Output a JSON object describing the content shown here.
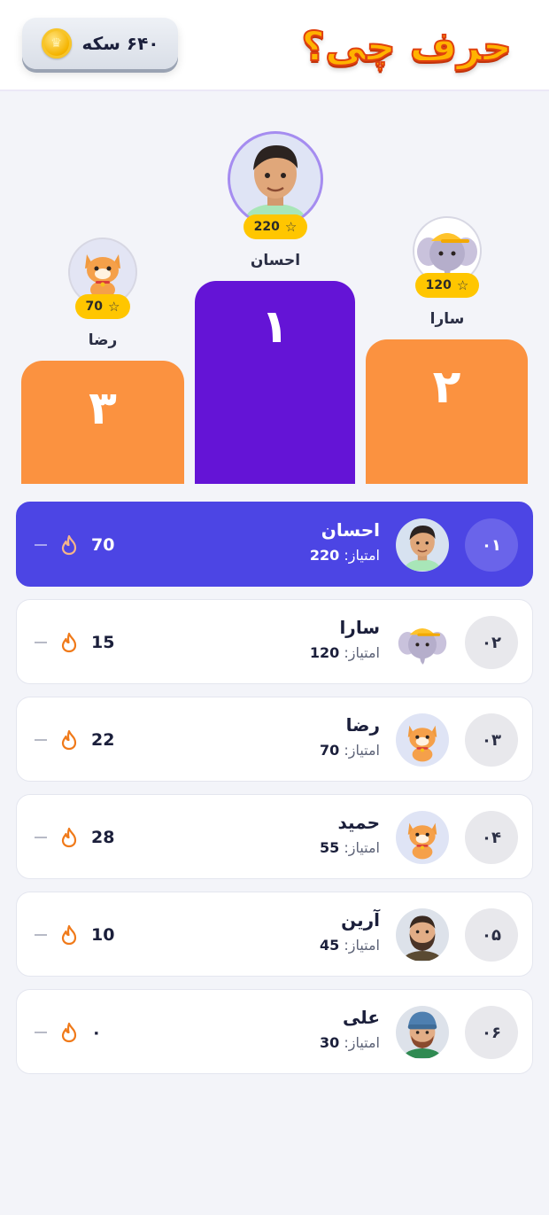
{
  "header": {
    "logo_text": "حرف چی؟",
    "coins": "۶۴۰ سکه",
    "coin_icon": "coin-icon"
  },
  "podium": [
    {
      "place": "۱",
      "name": "احسان",
      "score": "220",
      "avatar": "boy-avatar",
      "color": "#6414d6"
    },
    {
      "place": "۲",
      "name": "سارا",
      "score": "120",
      "avatar": "elephant-avatar",
      "color": "#fb9240"
    },
    {
      "place": "۳",
      "name": "رضا",
      "score": "70",
      "avatar": "cat-avatar",
      "color": "#fb9240"
    }
  ],
  "leaderboard": {
    "score_label": "امتیاز:",
    "rows": [
      {
        "rank": "۰۱",
        "name": "احسان",
        "score": "220",
        "streak": "70",
        "avatar": "boy-avatar",
        "active": true
      },
      {
        "rank": "۰۲",
        "name": "سارا",
        "score": "120",
        "streak": "15",
        "avatar": "elephant-avatar",
        "active": false
      },
      {
        "rank": "۰۳",
        "name": "رضا",
        "score": "70",
        "streak": "22",
        "avatar": "cat-avatar",
        "active": false
      },
      {
        "rank": "۰۴",
        "name": "حمید",
        "score": "55",
        "streak": "28",
        "avatar": "cat-avatar",
        "active": false
      },
      {
        "rank": "۰۵",
        "name": "آرین",
        "score": "45",
        "streak": "10",
        "avatar": "bearded-man-avatar",
        "active": false
      },
      {
        "rank": "۰۶",
        "name": "علی",
        "score": "30",
        "streak": "۰",
        "avatar": "beanie-man-avatar",
        "active": false
      }
    ]
  },
  "colors": {
    "accent": "#4c45e4",
    "first_place": "#6414d6",
    "podium_orange": "#fb9240",
    "badge": "#ffc600",
    "flame": "#f07a1a"
  }
}
